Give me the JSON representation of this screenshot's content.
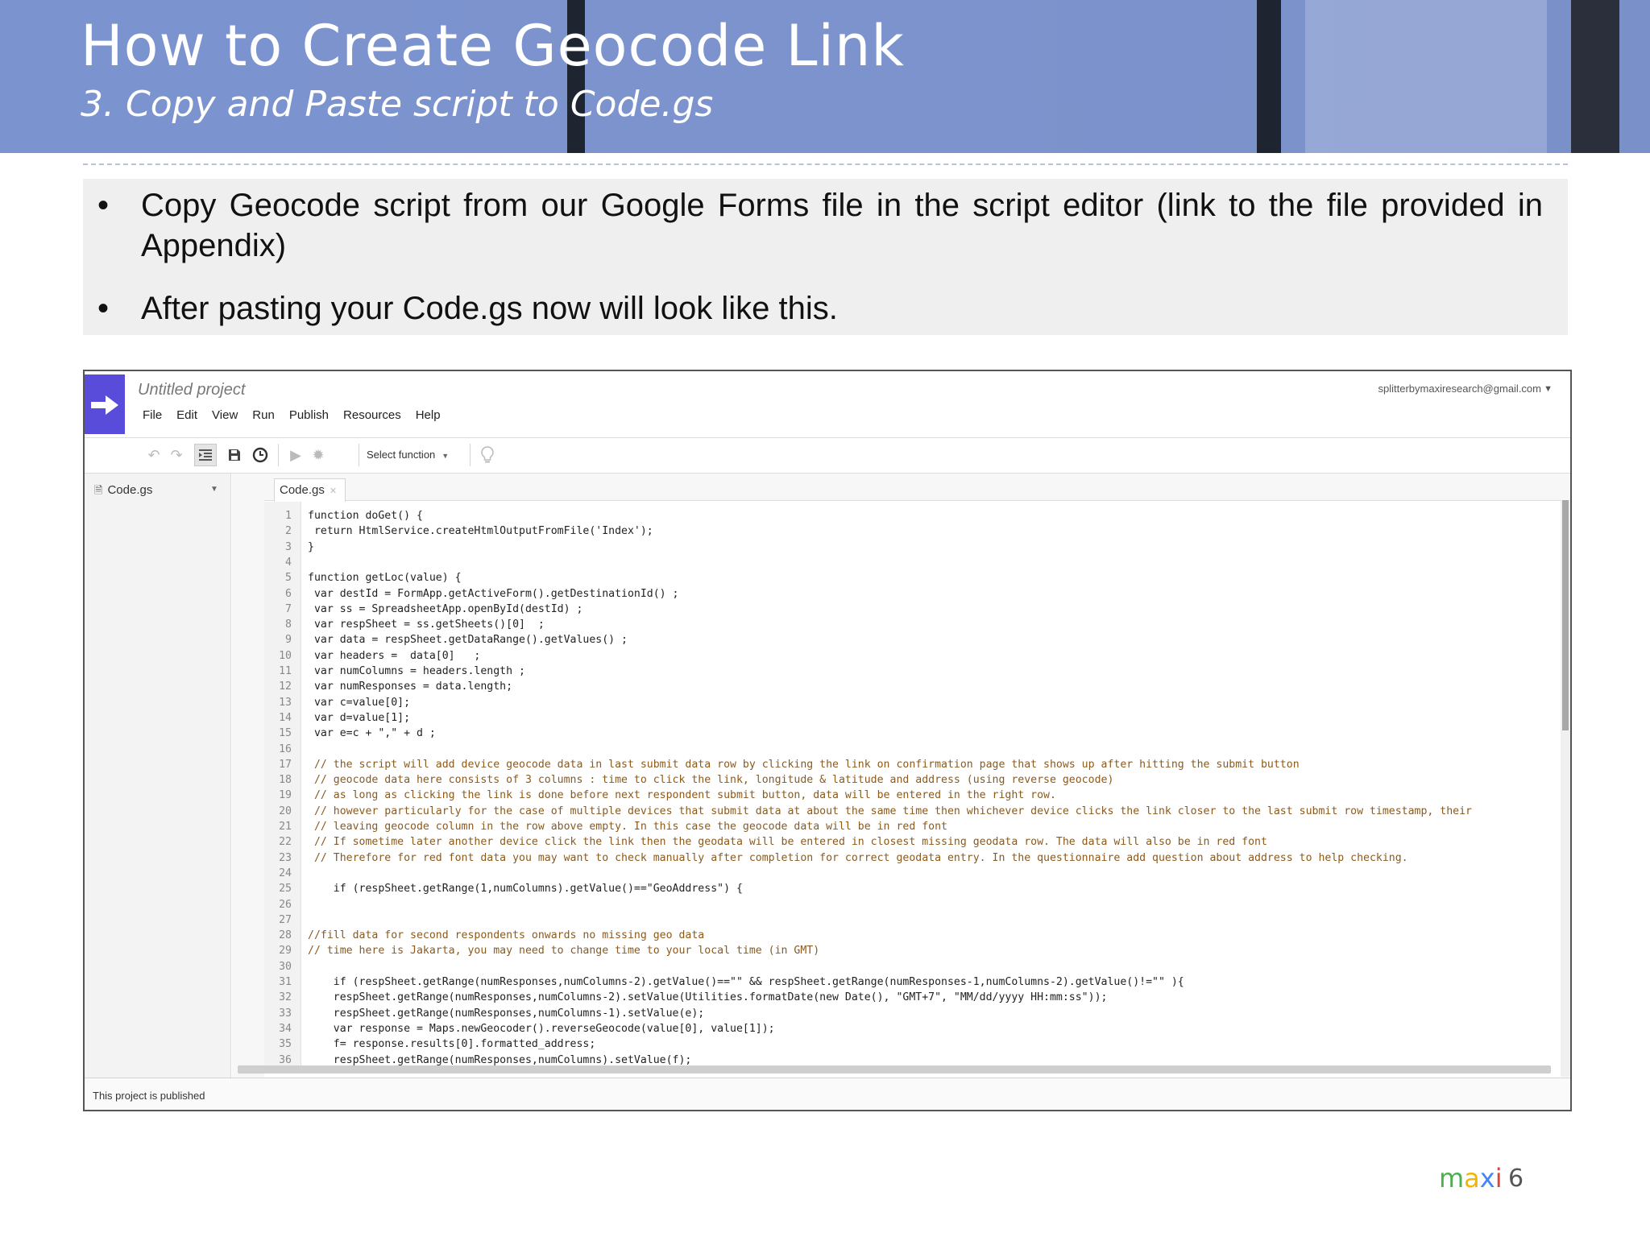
{
  "slide": {
    "title": "How to Create Geocode Link",
    "subtitle": "3. Copy and Paste script to Code.gs",
    "bullets": [
      "Copy Geocode script from our Google Forms file in the script editor (link to the file provided in Appendix)",
      "After pasting your Code.gs now will look like this."
    ],
    "bullet_symbol": "•",
    "brand": {
      "letters": [
        "m",
        "a",
        "x",
        "i"
      ],
      "colors": [
        "#4caf50",
        "#f4b400",
        "#4285f4",
        "#db4437"
      ]
    },
    "page_number": "6"
  },
  "editor": {
    "project_name": "Untitled project",
    "account": "splitterbymaxiresearch@gmail.com",
    "menu": [
      "File",
      "Edit",
      "View",
      "Run",
      "Publish",
      "Resources",
      "Help"
    ],
    "select_function": "Select function",
    "file_list": [
      "Code.gs"
    ],
    "tab_label": "Code.gs",
    "status": "This project is published",
    "accent_color": "#5a4cdb",
    "comment_color": "#8a5a1e",
    "code_lines": [
      {
        "n": "1",
        "text": "function doGet() {",
        "comment": false
      },
      {
        "n": "2",
        "text": " return HtmlService.createHtmlOutputFromFile('Index');",
        "comment": false
      },
      {
        "n": "3",
        "text": "}",
        "comment": false
      },
      {
        "n": "4",
        "text": "",
        "comment": false
      },
      {
        "n": "5",
        "text": "function getLoc(value) {",
        "comment": false
      },
      {
        "n": "6",
        "text": " var destId = FormApp.getActiveForm().getDestinationId() ;",
        "comment": false
      },
      {
        "n": "7",
        "text": " var ss = SpreadsheetApp.openById(destId) ;",
        "comment": false
      },
      {
        "n": "8",
        "text": " var respSheet = ss.getSheets()[0]  ;",
        "comment": false
      },
      {
        "n": "9",
        "text": " var data = respSheet.getDataRange().getValues() ;",
        "comment": false
      },
      {
        "n": "10",
        "text": " var headers =  data[0]   ;",
        "comment": false
      },
      {
        "n": "11",
        "text": " var numColumns = headers.length ;",
        "comment": false
      },
      {
        "n": "12",
        "text": " var numResponses = data.length;",
        "comment": false
      },
      {
        "n": "13",
        "text": " var c=value[0];",
        "comment": false
      },
      {
        "n": "14",
        "text": " var d=value[1];",
        "comment": false
      },
      {
        "n": "15",
        "text": " var e=c + \",\" + d ;",
        "comment": false
      },
      {
        "n": "16",
        "text": "",
        "comment": false
      },
      {
        "n": "17",
        "text": " // the script will add device geocode data in last submit data row by clicking the link on confirmation page that shows up after hitting the submit button",
        "comment": true
      },
      {
        "n": "18",
        "text": " // geocode data here consists of 3 columns : time to click the link, longitude & latitude and address (using reverse geocode)",
        "comment": true
      },
      {
        "n": "19",
        "text": " // as long as clicking the link is done before next respondent submit button, data will be entered in the right row.",
        "comment": true
      },
      {
        "n": "20",
        "text": " // however particularly for the case of multiple devices that submit data at about the same time then whichever device clicks the link closer to the last submit row timestamp, their",
        "comment": true
      },
      {
        "n": "21",
        "text": " // leaving geocode column in the row above empty. In this case the geocode data will be in red font",
        "comment": true
      },
      {
        "n": "22",
        "text": " // If sometime later another device click the link then the geodata will be entered in closest missing geodata row. The data will also be in red font",
        "comment": true
      },
      {
        "n": "23",
        "text": " // Therefore for red font data you may want to check manually after completion for correct geodata entry. In the questionnaire add question about address to help checking.",
        "comment": true
      },
      {
        "n": "24",
        "text": "",
        "comment": false
      },
      {
        "n": "25",
        "text": "    if (respSheet.getRange(1,numColumns).getValue()==\"GeoAddress\") {",
        "comment": false
      },
      {
        "n": "26",
        "text": "",
        "comment": false
      },
      {
        "n": "27",
        "text": "",
        "comment": false
      },
      {
        "n": "28",
        "text": "//fill data for second respondents onwards no missing geo data",
        "comment": true
      },
      {
        "n": "29",
        "text": "// time here is Jakarta, you may need to change time to your local time (in GMT)",
        "comment": true
      },
      {
        "n": "30",
        "text": "",
        "comment": false
      },
      {
        "n": "31",
        "text": "    if (respSheet.getRange(numResponses,numColumns-2).getValue()==\"\" && respSheet.getRange(numResponses-1,numColumns-2).getValue()!=\"\" ){",
        "comment": false
      },
      {
        "n": "32",
        "text": "    respSheet.getRange(numResponses,numColumns-2).setValue(Utilities.formatDate(new Date(), \"GMT+7\", \"MM/dd/yyyy HH:mm:ss\"));",
        "comment": false
      },
      {
        "n": "33",
        "text": "    respSheet.getRange(numResponses,numColumns-1).setValue(e);",
        "comment": false
      },
      {
        "n": "34",
        "text": "    var response = Maps.newGeocoder().reverseGeocode(value[0], value[1]);",
        "comment": false
      },
      {
        "n": "35",
        "text": "    f= response.results[0].formatted_address;",
        "comment": false
      },
      {
        "n": "36",
        "text": "    respSheet.getRange(numResponses,numColumns).setValue(f);",
        "comment": false
      }
    ]
  }
}
